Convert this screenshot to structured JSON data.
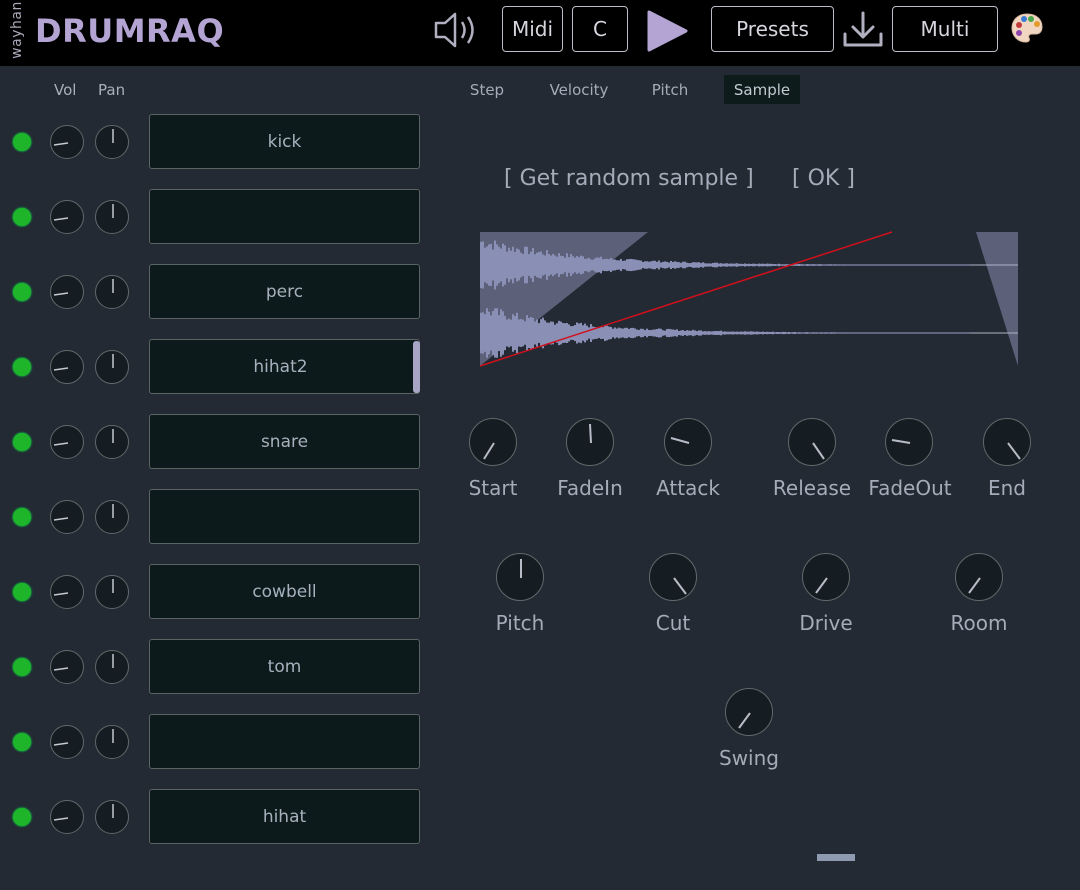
{
  "header": {
    "maker": "wayhan",
    "title": "DRUMRAQ",
    "midi_label": "Midi",
    "key_label": "C",
    "presets_label": "Presets",
    "multi_label": "Multi",
    "icons": [
      "speaker-icon",
      "play-icon",
      "download-icon",
      "palette-icon"
    ]
  },
  "mixer": {
    "vol_label": "Vol",
    "pan_label": "Pan"
  },
  "tracks": [
    {
      "name": "kick",
      "enabled": true
    },
    {
      "name": "",
      "enabled": true
    },
    {
      "name": "perc",
      "enabled": true
    },
    {
      "name": "hihat2",
      "enabled": true
    },
    {
      "name": "snare",
      "enabled": true
    },
    {
      "name": "",
      "enabled": true
    },
    {
      "name": "cowbell",
      "enabled": true
    },
    {
      "name": "tom",
      "enabled": true
    },
    {
      "name": "",
      "enabled": true
    },
    {
      "name": "hihat",
      "enabled": true
    }
  ],
  "tabs": {
    "step": "Step",
    "velocity": "Velocity",
    "pitch": "Pitch",
    "sample": "Sample",
    "active": "Sample"
  },
  "sample_actions": {
    "random": "[ Get random sample ]",
    "ok": "[ OK ]"
  },
  "knobs": {
    "start": "Start",
    "fadein": "FadeIn",
    "attack": "Attack",
    "release": "Release",
    "fadeout": "FadeOut",
    "end": "End",
    "pitch": "Pitch",
    "cut": "Cut",
    "drive": "Drive",
    "room": "Room",
    "swing": "Swing"
  },
  "colors": {
    "led_on": "#1fb52a",
    "accent": "#b4a4d4",
    "waveform": "#8a8fb5",
    "envelope_line": "#d0101c"
  }
}
